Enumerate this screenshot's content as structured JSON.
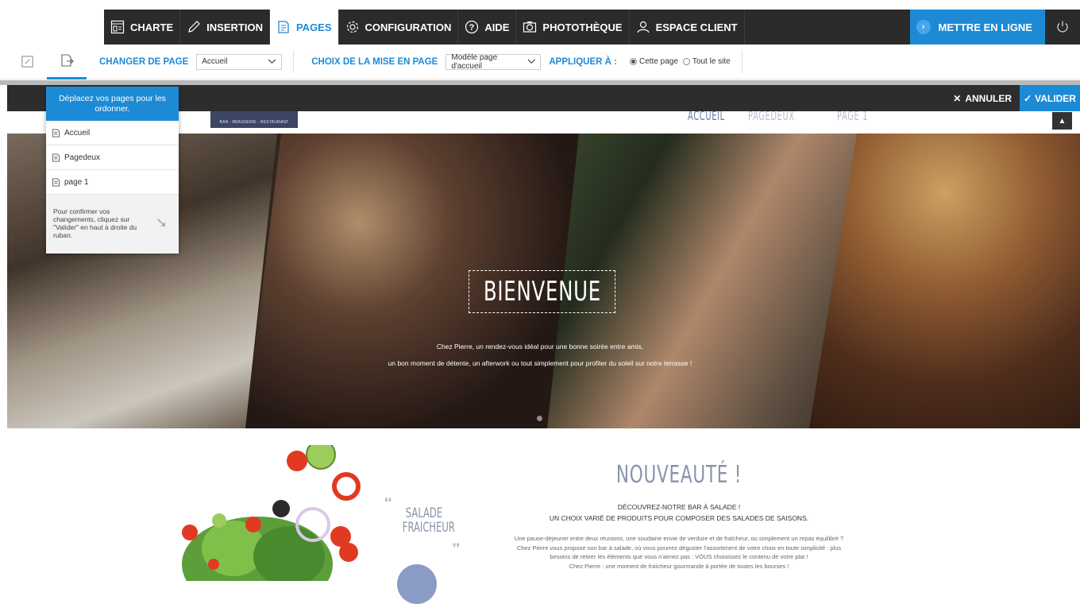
{
  "topnav": {
    "items": [
      {
        "label": "CHARTE",
        "icon": "layout-icon"
      },
      {
        "label": "INSERTION",
        "icon": "pencil-icon"
      },
      {
        "label": "PAGES",
        "icon": "page-icon",
        "active": true
      },
      {
        "label": "CONFIGURATION",
        "icon": "gear-icon"
      },
      {
        "label": "AIDE",
        "icon": "help-icon"
      },
      {
        "label": "PHOTOTHÈQUE",
        "icon": "camera-icon"
      },
      {
        "label": "ESPACE CLIENT",
        "icon": "user-icon"
      }
    ],
    "publish_label": "METTRE EN LIGNE",
    "accent": "#1d8ad6"
  },
  "ribbon": {
    "change_page_label": "CHANGER DE PAGE",
    "change_page_value": "Accueil",
    "layout_label": "CHOIX DE LA MISE EN PAGE",
    "layout_value": "Modèle page d'accueil",
    "apply_label": "APPLIQUER À :",
    "apply_options": [
      {
        "label": "Cette page",
        "checked": true
      },
      {
        "label": "Tout le site",
        "checked": false
      }
    ]
  },
  "actionbar": {
    "cancel_label": "ANNULER",
    "validate_label": "VALIDER"
  },
  "dropdown": {
    "header": "Déplacez vos pages pour les ordonner.",
    "pages": [
      "Accueil",
      "Pagedeux",
      "page 1"
    ],
    "footer": "Pour confirmer vos changements, cliquez sur \"Valider\" en haut à droite du ruban."
  },
  "site": {
    "logo_text": "BAR - BRASSERIE - RESTAURANT",
    "nav": [
      "ACCUEIL",
      "PAGEDEUX",
      "PAGE 1"
    ],
    "hero": {
      "title": "BIENVENUE",
      "line1": "Chez Pierre, un rendez-vous idéal pour une bonne soirée entre amis,",
      "line2": "un bon moment de détente, un afterwork ou tout simplement pour profiter du soleil sur notre terrasse !"
    },
    "salad_title_1": "SALADE",
    "salad_title_2": "FRAICHEUR",
    "news_title": "NOUVEAUTÉ !",
    "news_sub1": "DÉCOUVREZ-NOTRE BAR À SALADE !",
    "news_sub2": "UN CHOIX VARIÉ DE PRODUITS POUR COMPOSER DES SALADES DE SAISONS.",
    "news_body": [
      "Une pause-déjeuner entre deux réunions, une soudaine envie de verdure et de fraîcheur, ou simplement un repas équilibré ?",
      "Chez Pierre vous propose son bar à salade, où vous pourrez déguster l'assortiment de votre choix en toute simplicité : plus",
      "besoins de retirer les éléments que vous n'aimez pas : VOUS choisissez le contenu de votre plat !",
      "Chez Pierre : une moment de fraîcheur gourmande à portée de toutes les bourses !"
    ]
  }
}
